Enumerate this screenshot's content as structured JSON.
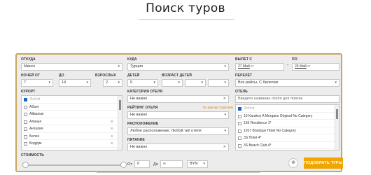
{
  "page": {
    "title": "Поиск туров"
  },
  "form": {
    "from": {
      "label": "ОТКУДА",
      "value": "Минск"
    },
    "to": {
      "label": "КУДА",
      "value": "Турция"
    },
    "depart_label": "ВЫЛЕТ С",
    "date_from": {
      "value": "27 Май",
      "weekday": "вт"
    },
    "date_until_label": "ПО",
    "date_to": {
      "value": "26 Май",
      "weekday": "вт"
    },
    "nights_from": {
      "label": "НОЧЕЙ ОТ",
      "value": "7"
    },
    "nights_to": {
      "label": "ДО",
      "value": "14"
    },
    "adults": {
      "label": "ВЗРОСЛЫХ",
      "value": "2"
    },
    "children": {
      "label": "ДЕТЕЙ",
      "value": "0"
    },
    "children_age_label": "ВОЗРАСТ ДЕТЕЙ",
    "flight": {
      "label": "ПЕРЕЛЁТ",
      "value": "Все рейсы, С билетом"
    },
    "resort": {
      "label": "КУРОРТ",
      "items": [
        {
          "name": "Любой",
          "checked": true,
          "muted": true
        },
        {
          "name": "Абант",
          "checked": false
        },
        {
          "name": "Айвалык",
          "checked": false
        },
        {
          "name": "Аланья",
          "checked": false,
          "star": true
        },
        {
          "name": "Анталия",
          "checked": false,
          "star": true
        },
        {
          "name": "Белек",
          "checked": false,
          "star": true
        },
        {
          "name": "Бодрум",
          "checked": false,
          "star": true
        }
      ]
    },
    "category": {
      "label": "КАТЕГОРИЯ ОТЕЛЯ",
      "value": "Не важно"
    },
    "rating": {
      "label": "РЕЙТИНГ ОТЕЛЯ",
      "link": "По версии TopHotels",
      "value": "Не важно"
    },
    "location": {
      "label": "РАСПОЛОЖЕНИЕ",
      "value": "Любое расположение, Любой тип отеля"
    },
    "meal": {
      "label": "ПИТАНИЕ",
      "value": "Не важно"
    },
    "hotel": {
      "label": "ОТЕЛЬ",
      "placeholder": "Введите название отеля для поиска",
      "items": [
        {
          "name": "Любой",
          "checked": true,
          "muted": true
        },
        {
          "name": "10 Karakoy A Morgans Original No Category",
          "checked": false
        },
        {
          "name": "155 Residence 1*",
          "checked": false
        },
        {
          "name": "1207 Boutique Hotel No Category",
          "checked": false
        },
        {
          "name": "3S Hotel 4*",
          "checked": false
        },
        {
          "name": "3S Beach Club 4*",
          "checked": false
        }
      ]
    },
    "price": {
      "label": "СТОИМОСТЬ",
      "from_label": "От",
      "from_value": "0",
      "to_label": "До",
      "to_value": "∞",
      "currency": "BYN"
    },
    "search_button": "ПОДОБРАТЬ ТУРЫ",
    "reset_icon": "reset-icon"
  },
  "colors": {
    "accent": "#f0a500",
    "border": "#c9a75c",
    "checkbox": "#1a66c4"
  }
}
